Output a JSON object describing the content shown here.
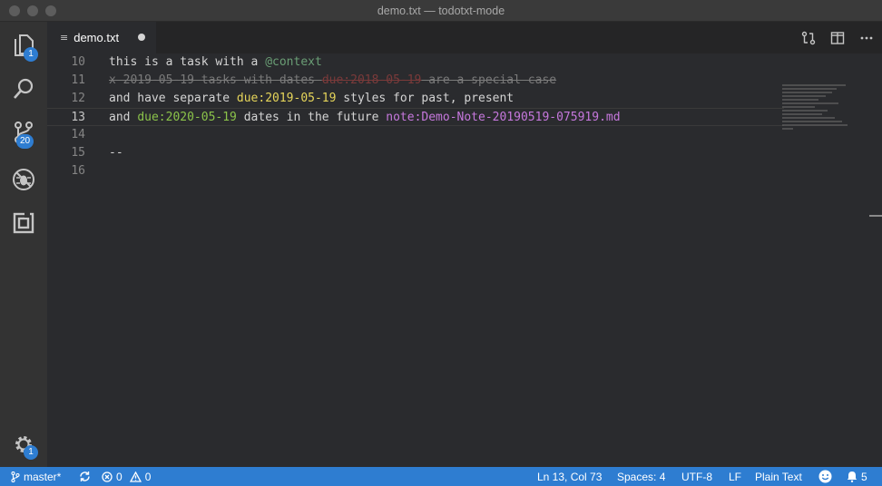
{
  "window": {
    "title": "demo.txt — todotxt-mode"
  },
  "activity": {
    "explorer_badge": "1",
    "scm_badge": "20",
    "settings_badge": "1"
  },
  "tab": {
    "name": "demo.txt",
    "file_icon": "≡"
  },
  "editor": {
    "lines": [
      {
        "num": "10",
        "t1": "this is a task with a ",
        "ctx": "@context"
      },
      {
        "num": "11",
        "done1": "x 2019-05-19 tasks with dates ",
        "due": "due:2018-05-19",
        "done2": " are a special case"
      },
      {
        "num": "12",
        "t1": "and have separate ",
        "due": "due:2019-05-19",
        "t2": " styles for past, present"
      },
      {
        "num": "13",
        "t1": "and ",
        "due": "due:2020-05-19",
        "t2": " dates in the future ",
        "note": "note:Demo-Note-20190519-075919.md"
      },
      {
        "num": "14"
      },
      {
        "num": "15",
        "t1": "--"
      },
      {
        "num": "16"
      }
    ]
  },
  "status": {
    "branch": "master*",
    "errors": "0",
    "warnings": "0",
    "position": "Ln 13, Col 73",
    "spaces": "Spaces: 4",
    "encoding": "UTF-8",
    "eol": "LF",
    "language": "Plain Text",
    "notifications": "5"
  },
  "colors": {
    "statusbar": "#2e7dd1",
    "context": "#6a9e75",
    "due_past": "#7a3a3a",
    "due_present": "#e6d55a",
    "due_future": "#8bc34a",
    "note": "#c678dd"
  }
}
